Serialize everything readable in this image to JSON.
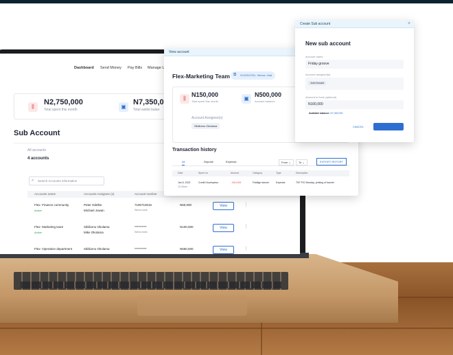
{
  "nav": {
    "items": [
      "Dashboard",
      "Send Money",
      "Pay Bills",
      "Manage U"
    ]
  },
  "stats": {
    "spent_value": "N2,750,000",
    "spent_label": "Total spent this month",
    "wallet_value": "N7,350,00",
    "wallet_label": "Total wallet balan"
  },
  "sub_account": {
    "title": "Sub Account",
    "all_accounts_label": "All accounts",
    "count": "4 accounts",
    "search_placeholder": "Search Accounts information",
    "columns": [
      "Accounts name",
      "Accounts Assignee (s)",
      "Account number"
    ],
    "rows": [
      {
        "name": "Flex- Finance community",
        "status": "Active",
        "assignee1": "Peter Odelke",
        "assignee2": "Michael Jowan",
        "number": "7190710015",
        "bank": "Wema bank",
        "amount": "N60,000",
        "action": "View"
      },
      {
        "name": "Flex- Marketing team",
        "status": "Active",
        "assignee1": "Sibiliomo Okolama",
        "assignee2": "Mike Okolama",
        "number": "**********",
        "bank": "Wema bank",
        "amount": "N100,000",
        "action": "View"
      },
      {
        "name": "Flex- Operation department",
        "status": "",
        "assignee1": "Sibiliomo Okolama",
        "assignee2": "",
        "number": "**********",
        "bank": "",
        "amount": "N560,000",
        "action": "View"
      }
    ]
  },
  "view_account": {
    "header": "View account",
    "title": "Flex-Marketing Team",
    "account_tag": "9120310761- Wema / Alat",
    "spent_value": "N150,000",
    "spent_label": "Total spent this month",
    "balance_value": "N500,000",
    "balance_label": "Account balance",
    "assignee_label": "Account Assignee(s)",
    "assignee_chip": "Sibiliomo Okolama",
    "history_title": "Transaction history",
    "tabs": [
      "All",
      "Deposit",
      "Expense"
    ],
    "filter_from": "From",
    "filter_to": "To",
    "export_label": "EXPORT REPORT",
    "columns": [
      "Date",
      "Spent on",
      "Amount",
      "Category",
      "Type",
      "Description"
    ],
    "row": {
      "date": "Jan 5, 2023",
      "time": "10:45am",
      "spent_on": "Credit Onuehyewo",
      "amount": "- N10,000",
      "category": "Fiddlige banner",
      "type": "Expense",
      "description": "TSF P/O Monday, printing of banner"
    }
  },
  "create_sub": {
    "header": "Create Sub account",
    "title": "New sub account",
    "name_label": "Account name",
    "name_value": "Friday groove",
    "assigned_label": "Account assigned(s)",
    "assigned_chip": "John Donald",
    "fund_label": "Amount to fund (optional)",
    "fund_value": "N100,000",
    "available_label": "Available balance:",
    "available_value": "N7,350,000",
    "cancel_label": "CANCEL",
    "close_glyph": "×"
  },
  "colors": {
    "accent": "#2d6fd0",
    "danger": "#e04b4b",
    "success": "#1a9e4a",
    "modal_header": "#e9f4fb"
  }
}
